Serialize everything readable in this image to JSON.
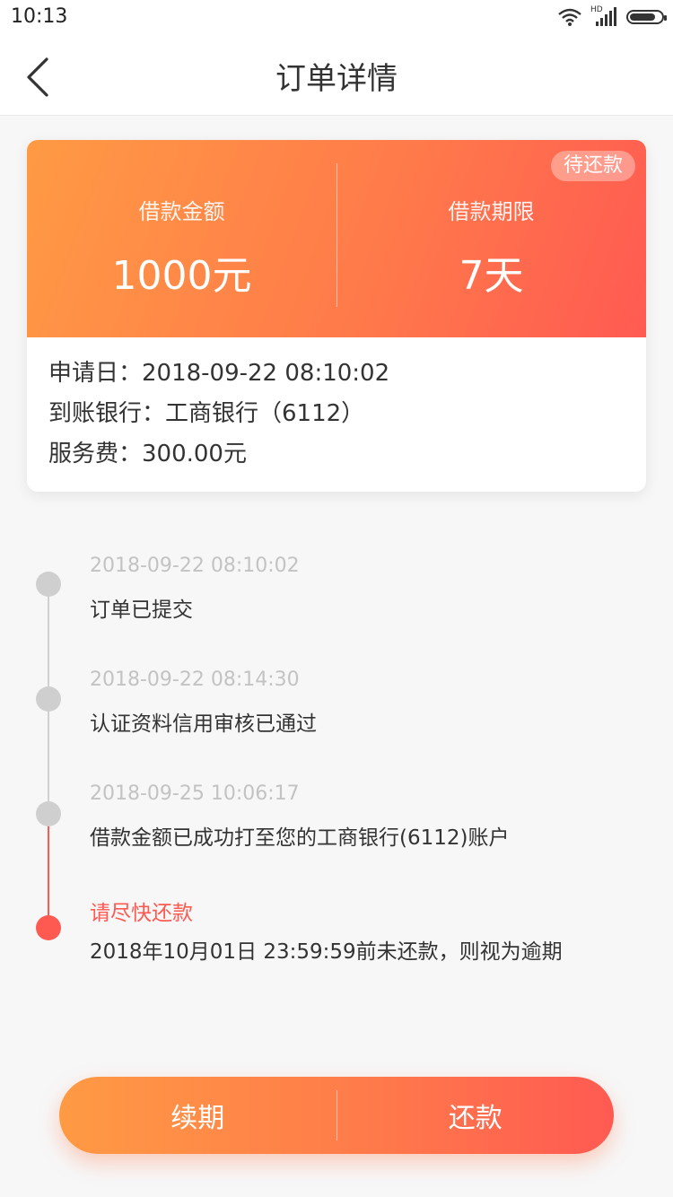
{
  "status_bar": {
    "time": "10:13",
    "network": "HD"
  },
  "header": {
    "title": "订单详情"
  },
  "summary": {
    "badge": "待还款",
    "amount_label": "借款金额",
    "amount_value": "1000元",
    "term_label": "借款期限",
    "term_value": "7天"
  },
  "details": {
    "apply_date": "申请日：2018-09-22   08:10:02",
    "bank": "到账银行：工商银行（6112）",
    "fee": "服务费：300.00元"
  },
  "timeline": [
    {
      "time": "2018-09-22   08:10:02",
      "text": "订单已提交"
    },
    {
      "time": "2018-09-22   08:14:30",
      "text": "认证资料信用审核已通过"
    },
    {
      "time": "2018-09-25   10:06:17",
      "text": "借款金额已成功打至您的工商银行(6112)账户"
    },
    {
      "time": "请尽快还款",
      "text": "2018年10月01日 23:59:59前未还款，则视为逾期"
    }
  ],
  "actions": {
    "renew": "续期",
    "repay": "还款"
  },
  "colors": {
    "accent_start": "#ff9a44",
    "accent_end": "#ff5a52",
    "warning": "#ff5a52"
  }
}
